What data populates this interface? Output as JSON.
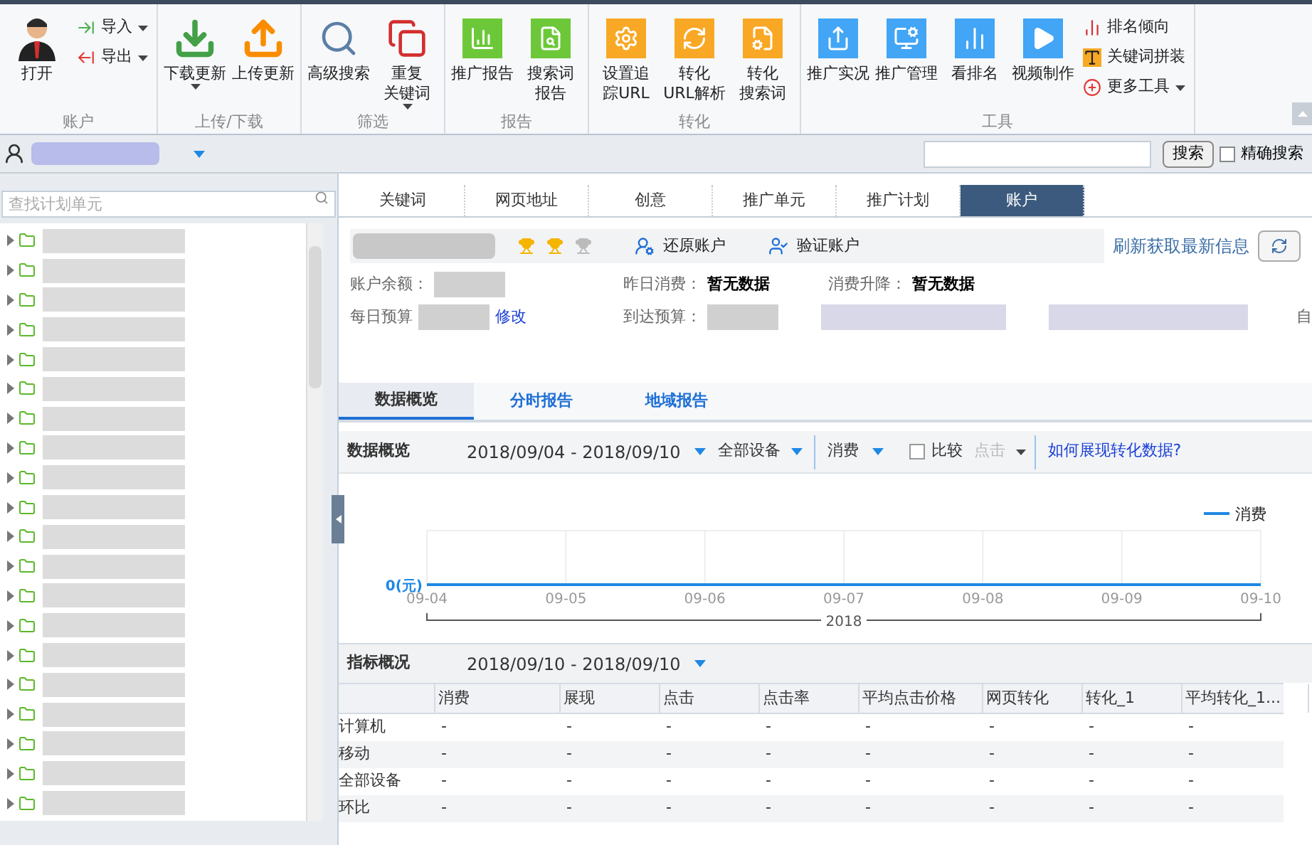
{
  "ribbon": {
    "groups": [
      {
        "label": "账户",
        "buttons": [
          {
            "kind": "large",
            "lines": [
              "打开"
            ],
            "dropdown": false
          },
          {
            "kind": "small",
            "lines": [
              "导入"
            ],
            "dropdown": true
          },
          {
            "kind": "small",
            "lines": [
              "导出"
            ],
            "dropdown": true
          }
        ]
      },
      {
        "label": "上传/下载",
        "buttons": [
          {
            "kind": "large",
            "lines": [
              "下载更新"
            ],
            "dropdown": true
          },
          {
            "kind": "large",
            "lines": [
              "上传更新"
            ],
            "dropdown": false
          }
        ]
      },
      {
        "label": "筛选",
        "buttons": [
          {
            "kind": "large",
            "lines": [
              "高级搜索"
            ],
            "dropdown": false
          },
          {
            "kind": "large",
            "lines": [
              "重复",
              "关键词"
            ],
            "dropdown": true
          }
        ]
      },
      {
        "label": "报告",
        "buttons": [
          {
            "kind": "large",
            "lines": [
              "推广报告"
            ],
            "dropdown": false
          },
          {
            "kind": "large",
            "lines": [
              "搜索词",
              "报告"
            ],
            "dropdown": false
          }
        ]
      },
      {
        "label": "转化",
        "buttons": [
          {
            "kind": "large",
            "lines": [
              "设置追",
              "踪URL"
            ],
            "dropdown": false
          },
          {
            "kind": "large",
            "lines": [
              "转化",
              "URL解析"
            ],
            "dropdown": false
          },
          {
            "kind": "large",
            "lines": [
              "转化",
              "搜索词"
            ],
            "dropdown": false
          }
        ]
      },
      {
        "label": "工具",
        "buttons": [
          {
            "kind": "large",
            "lines": [
              "推广实况"
            ],
            "dropdown": false
          },
          {
            "kind": "large",
            "lines": [
              "推广管理"
            ],
            "dropdown": false
          },
          {
            "kind": "large",
            "lines": [
              "看排名"
            ],
            "dropdown": false
          },
          {
            "kind": "large",
            "lines": [
              "视频制作"
            ],
            "dropdown": false
          },
          {
            "kind": "small",
            "lines": [
              "排名倾向"
            ],
            "dropdown": false
          },
          {
            "kind": "small",
            "lines": [
              "关键词拼装"
            ],
            "dropdown": false
          },
          {
            "kind": "small",
            "lines": [
              "更多工具"
            ],
            "dropdown": true
          }
        ]
      }
    ]
  },
  "account_bar": {
    "search_button": "搜索",
    "exact_search": {
      "label": "精确搜索",
      "checked": false
    }
  },
  "sidebar": {
    "search": {
      "placeholder": "查找计划单元"
    }
  },
  "tabs": [
    {
      "label": "关键词",
      "selected": false
    },
    {
      "label": "网页地址",
      "selected": false
    },
    {
      "label": "创意",
      "selected": false
    },
    {
      "label": "推广单元",
      "selected": false
    },
    {
      "label": "推广计划",
      "selected": false
    },
    {
      "label": "账户",
      "selected": true
    }
  ],
  "account": {
    "stars": 2,
    "actions": [
      "还原账户",
      "验证账户"
    ],
    "refresh_link": "刷新获取最新信息",
    "fields": [
      {
        "label": "账户余额："
      },
      {
        "label": "昨日消费：",
        "value": "暂无数据"
      },
      {
        "label": "消费升降：",
        "value": "暂无数据"
      },
      {
        "label": "每日预算",
        "link": "修改"
      },
      {
        "label": "到达预算："
      }
    ],
    "edge_text": "自"
  },
  "sub_tabs": [
    {
      "label": "数据概览",
      "selected": true
    },
    {
      "label": "分时报告",
      "selected": false
    },
    {
      "label": "地域报告",
      "selected": false
    }
  ],
  "overview_toolbar": {
    "title": "数据概览",
    "date_range": "2018/09/04 - 2018/09/10",
    "device": "全部设备",
    "metric": "消费",
    "compare": {
      "label": "比较",
      "checked": false
    },
    "compare_metric": {
      "label": "点击",
      "disabled": true
    },
    "help_link": "如何展现转化数据?"
  },
  "trend_chart": {
    "legend": "消费",
    "y_label": "0(元)",
    "x_labels": [
      "09-04",
      "09-05",
      "09-06",
      "09-07",
      "09-08",
      "09-09",
      "09-10"
    ],
    "year_label": "2018"
  },
  "metrics": {
    "title": "指标概况",
    "date_range": "2018/09/10 - 2018/09/10",
    "columns": [
      "消费",
      "展现",
      "点击",
      "点击率",
      "平均点击价格",
      "网页转化",
      "转化_1",
      "平均转化_1..."
    ],
    "rows": [
      {
        "label": "计算机",
        "cells": [
          "-",
          "-",
          "-",
          "-",
          "-",
          "-",
          "-",
          "-"
        ]
      },
      {
        "label": "移动",
        "cells": [
          "-",
          "-",
          "-",
          "-",
          "-",
          "-",
          "-",
          "-"
        ]
      },
      {
        "label": "全部设备",
        "cells": [
          "-",
          "-",
          "-",
          "-",
          "-",
          "-",
          "-",
          "-"
        ]
      },
      {
        "label": "环比",
        "cells": [
          "-",
          "-",
          "-",
          "-",
          "-",
          "-",
          "-",
          "-"
        ]
      }
    ]
  }
}
